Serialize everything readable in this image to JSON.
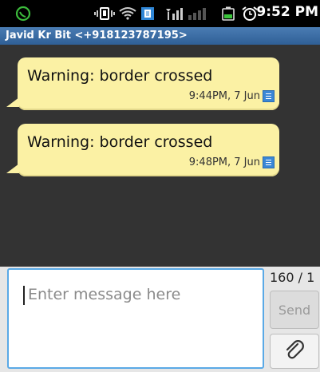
{
  "status_bar": {
    "time": "9:52 PM",
    "icons": [
      "whatsapp-icon",
      "vibrate-icon",
      "wifi-icon",
      "notification-icon",
      "signal-icon",
      "battery-icon",
      "alarm-icon"
    ]
  },
  "conversation": {
    "contact": "Javid Kr Bit <+918123787195>"
  },
  "messages": [
    {
      "text": "Warning: border crossed",
      "time": "9:44PM, 7 Jun"
    },
    {
      "text": "Warning: border crossed",
      "time": "9:48PM, 7 Jun"
    }
  ],
  "compose": {
    "placeholder": "Enter message here",
    "counter": "160 / 1",
    "send_label": "Send"
  },
  "colors": {
    "header": "#3a6ca6",
    "bubble": "#fbf1a4",
    "background": "#333333",
    "input_border": "#5aa9e6"
  }
}
